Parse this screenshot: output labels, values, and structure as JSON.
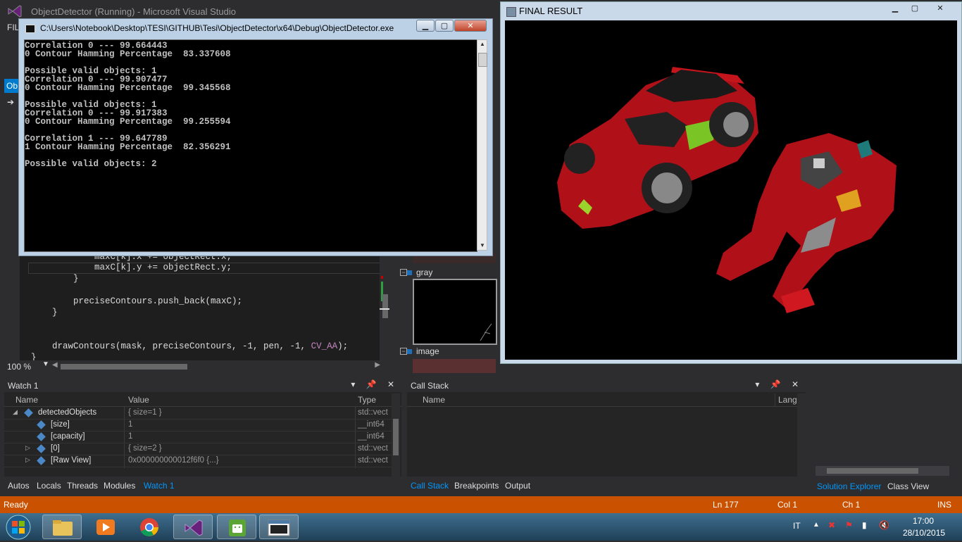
{
  "vs": {
    "title": "ObjectDetector (Running) - Microsoft Visual Studio",
    "menu_first": "FIL",
    "doc_tab_partial": "Ob"
  },
  "editor": {
    "lines": [
      "            maxC[k].x += objectRect.x;",
      "            maxC[k].y += objectRect.y;",
      "        }",
      "",
      "        preciseContours.push_back(maxC);",
      "    }",
      "",
      "",
      "    drawContours(mask, preciseContours, -1, pen, -1, ",
      "}"
    ],
    "macro": "CV_AA",
    "macro_tail": ");",
    "zoom": "100 %"
  },
  "image_watch": {
    "items": [
      {
        "name": "gray"
      },
      {
        "name": "image"
      }
    ]
  },
  "console": {
    "title": "C:\\Users\\Notebook\\Desktop\\TESI\\GITHUB\\Tesi\\ObjectDetector\\x64\\Debug\\ObjectDetector.exe",
    "output": "Correlation 0 --- 99.664443\n0 Contour Hamming Percentage  83.337608\n\nPossible valid objects: 1\nCorrelation 0 --- 99.907477\n0 Contour Hamming Percentage  99.345568\n\nPossible valid objects: 1\nCorrelation 0 --- 99.917383\n0 Contour Hamming Percentage  99.255594\n\nCorrelation 1 --- 99.647789\n1 Contour Hamming Percentage  82.356291\n\nPossible valid objects: 2"
  },
  "final_window": {
    "title": "FINAL RESULT"
  },
  "watch": {
    "title": "Watch 1",
    "columns": [
      "Name",
      "Value",
      "Type"
    ],
    "rows": [
      {
        "name": "detectedObjects",
        "value": "{ size=1 }",
        "type": "std::vect",
        "indent": 0,
        "expander": "◢"
      },
      {
        "name": "[size]",
        "value": "1",
        "type": "__int64",
        "indent": 1,
        "expander": ""
      },
      {
        "name": "[capacity]",
        "value": "1",
        "type": "__int64",
        "indent": 1,
        "expander": ""
      },
      {
        "name": "[0]",
        "value": "{ size=2 }",
        "type": "std::vect",
        "indent": 1,
        "expander": "▷"
      },
      {
        "name": "[Raw View]",
        "value": "0x000000000012f6f0 {...}",
        "type": "std::vect",
        "indent": 1,
        "expander": "▷"
      }
    ],
    "tabs": [
      "Autos",
      "Locals",
      "Threads",
      "Modules",
      "Watch 1"
    ]
  },
  "callstack": {
    "title": "Call Stack",
    "columns": [
      "Name",
      "Lang"
    ],
    "tabs": [
      "Call Stack",
      "Breakpoints",
      "Output"
    ]
  },
  "right_tabs": [
    "Solution Explorer",
    "Class View"
  ],
  "status": {
    "state": "Ready",
    "ln": "Ln 177",
    "col": "Col 1",
    "ch": "Ch 1",
    "mode": "INS"
  },
  "taskbar": {
    "lang": "IT",
    "time": "17:00",
    "date": "28/10/2015"
  },
  "colors": {
    "status_bar": "#ca5100",
    "accent": "#007acc",
    "vs_purple": "#68217a"
  }
}
